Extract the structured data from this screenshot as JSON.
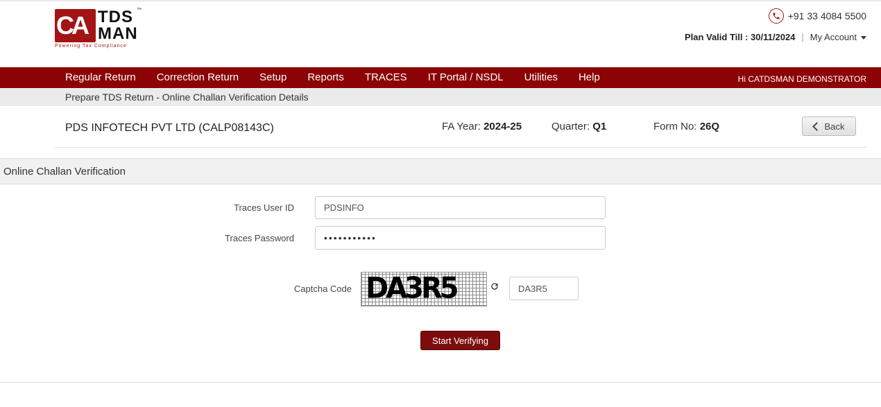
{
  "logo": {
    "letters": "CA",
    "line1": "TDS",
    "line2": "MAN",
    "tm": "™",
    "tagline": "Powering Tax Compliance"
  },
  "header": {
    "phone": "+91 33 4084 5500",
    "plan_label": "Plan Valid Till : 30/11/2024",
    "separator": "|",
    "my_account": "My Account"
  },
  "nav": {
    "items": [
      "Regular Return",
      "Correction Return",
      "Setup",
      "Reports",
      "TRACES",
      "IT Portal / NSDL",
      "Utilities",
      "Help"
    ],
    "greeting": "Hi CATDSMAN DEMONSTRATOR"
  },
  "breadcrumb": "Prepare TDS Return - Online Challan Verification Details",
  "company": {
    "name": "PDS INFOTECH PVT LTD (CALP08143C)",
    "fa_label": "FA Year:",
    "fa_value": "2024-25",
    "quarter_label": "Quarter:",
    "quarter_value": "Q1",
    "form_label": "Form No:",
    "form_value": "26Q",
    "back_label": "Back"
  },
  "section": {
    "title": "Online Challan Verification"
  },
  "form": {
    "user_id_label": "Traces User ID",
    "user_id_value": "PDSINFO",
    "password_label": "Traces Password",
    "password_value": "•••••••••••",
    "captcha_label": "Captcha Code",
    "captcha_image_text": "DA3R5",
    "captcha_value": "DA3R5",
    "refresh_icon": "refresh-icon",
    "submit_label": "Start Verifying"
  },
  "colors": {
    "brand": "#8b0304",
    "button": "#7d0d0d",
    "subbar": "#ebebeb"
  }
}
